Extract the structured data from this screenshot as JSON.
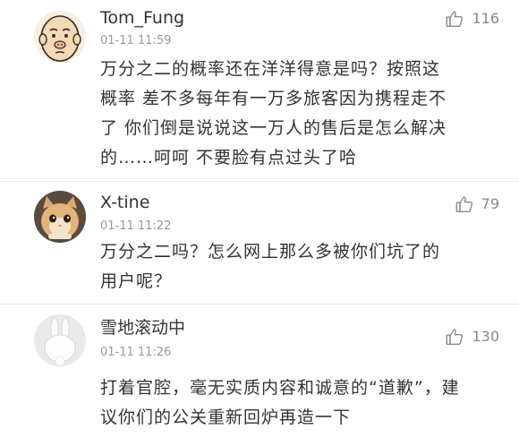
{
  "comments": [
    {
      "username": "Tom_Fung",
      "timestamp": "01-11 11:59",
      "likes": "116",
      "avatar_icon": "cartoon-face-avatar",
      "text": "万分之二的概率还在洋洋得意是吗？按照这\n概率 差不多每年有一万多旅客因为携程走不\n了 你们倒是说说这一万人的售后是怎么解决\n的……呵呵 不要脸有点过头了哈"
    },
    {
      "username": "X-tine",
      "timestamp": "01-11 11:22",
      "likes": "79",
      "avatar_icon": "kitten-photo-avatar",
      "text": "万分之二吗？怎么网上那么多被你们坑了的\n用户呢？"
    },
    {
      "username": "雪地滚动中",
      "timestamp": "01-11 11:26",
      "likes": "130",
      "avatar_icon": "white-rabbit-avatar",
      "text": "打着官腔，毫无实质内容和诚意的“道歉”，建\n议你们的公关重新回炉再造一下"
    }
  ],
  "like_icon": "thumbs-up-icon",
  "colors": {
    "text": "#333333",
    "meta": "#999999",
    "like": "#8a8a8a",
    "divider": "#e6e6e6"
  }
}
